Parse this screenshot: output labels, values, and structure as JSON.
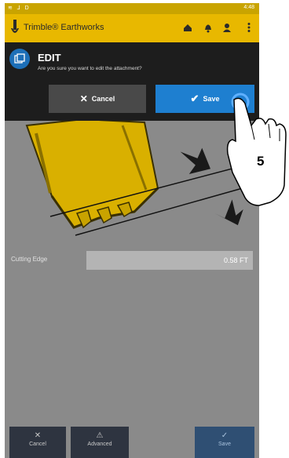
{
  "status_bar": {
    "left_text": "≋ ⅃ D",
    "time": "4:48"
  },
  "app": {
    "title": "Trimble® Earthworks"
  },
  "toolbar_icons": [
    "home-icon",
    "bell-icon",
    "user-icon",
    "more-icon"
  ],
  "dialog": {
    "title": "EDIT",
    "message": "Are you sure you want to edit the attachment?",
    "cancel_label": "Cancel",
    "save_label": "Save"
  },
  "form": {
    "cutting_edge_label": "Cutting Edge",
    "cutting_edge_value": "0.58 FT"
  },
  "bottom_bar": {
    "cancel_label": "Cancel",
    "advanced_label": "Advanced",
    "save_label": "Save"
  },
  "annotation": {
    "step_number": "5"
  },
  "colors": {
    "app_bar": "#e8b800",
    "status_bar": "#c9a400",
    "save_blue": "#1e7fd0",
    "dialog_bg": "#1d1d1d",
    "bucket_yellow": "#d9b000"
  }
}
